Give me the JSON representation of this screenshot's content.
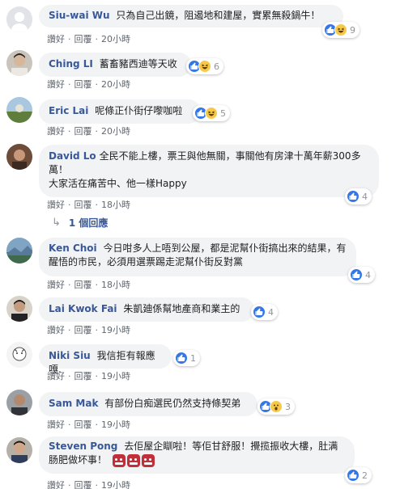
{
  "actions": {
    "like": "讚好",
    "reply": "回覆",
    "sep": "·"
  },
  "comments": [
    {
      "name": "Siu-wai Wu",
      "text": "只為自己出鏡，阻遏地和建屋，實累無殺鍋牛！",
      "time": "20小時",
      "reactions": [
        "like",
        "haha"
      ],
      "count": "9"
    },
    {
      "name": "Ching LI",
      "text": "蓄畜豬西迪等天收",
      "time": "20小時",
      "reactions": [
        "like",
        "haha"
      ],
      "count": "6"
    },
    {
      "name": "Eric Lai",
      "text": "呢條正仆街仔嚟咖啦",
      "time": "20小時",
      "reactions": [
        "like",
        "haha"
      ],
      "count": "5"
    },
    {
      "name": "David Lo",
      "text": "全民不能上樓，票王與他無關，事關他有房津十萬年薪300多萬！",
      "text2": "大家活在痛苦中、他一樣Happy",
      "time": "18小時",
      "reactions": [
        "like"
      ],
      "count": "4",
      "replies": "1 個回應"
    },
    {
      "name": "Ken Choi",
      "text": "今日咁多人上唔到公屋，都是泥幫仆街搞出來的結果，有醒悟的市民，必須用選票踢走泥幫仆街反對黨",
      "time": "18小時",
      "reactions": [
        "like"
      ],
      "count": "4"
    },
    {
      "name": "Lai Kwok Fai",
      "text": "朱凱廸係幫地產商和業主的",
      "time": "19小時",
      "reactions": [
        "like"
      ],
      "count": "4"
    },
    {
      "name": "Niki Siu",
      "text": "我信拒有報應嘎.",
      "time": "19小時",
      "reactions": [
        "like"
      ],
      "count": "1"
    },
    {
      "name": "Sam Mak",
      "text": "有部份白痴選民仍然支持條契弟",
      "time": "19小時",
      "reactions": [
        "like",
        "wow"
      ],
      "count": "3"
    },
    {
      "name": "Steven Pong",
      "text": "去佢屋企瞓啦！等佢甘舒服！攪揽振收大樓，肚满肠肥做坏事！",
      "time": "19小時",
      "reactions": [
        "like"
      ],
      "count": "2",
      "emoji": "ogre"
    }
  ]
}
